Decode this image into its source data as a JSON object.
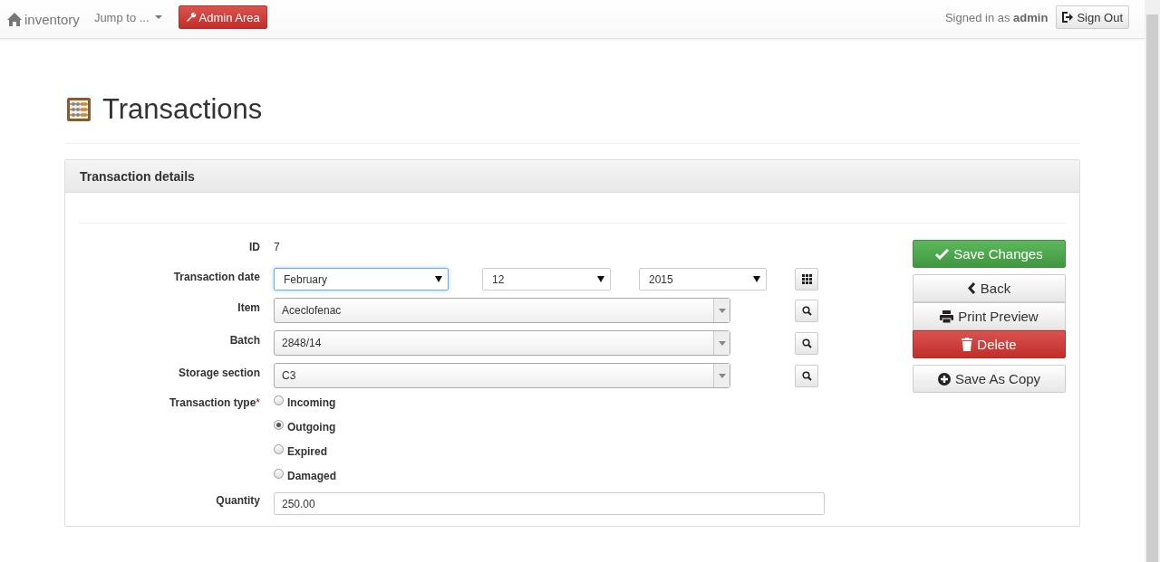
{
  "navbar": {
    "brand": "inventory",
    "jump_to": "Jump to ...",
    "admin_button": "Admin Area",
    "signed_in": "Signed in as **admin**",
    "sign_out": "Sign Out"
  },
  "page": {
    "title": "Transactions"
  },
  "panel": {
    "title": "Transaction details",
    "id": {
      "label": "ID",
      "value": "7"
    },
    "date": {
      "label": "Transaction date",
      "selects": [
        {
          "value": "February",
          "focused": true
        },
        {
          "value": "12",
          "focused": false
        },
        {
          "value": "2015",
          "focused": false
        }
      ]
    },
    "lookups": [
      {
        "label": "Item",
        "value": "Aceclofenac"
      },
      {
        "label": "Batch",
        "value": "2848/14"
      },
      {
        "label": "Storage section",
        "value": "C3"
      }
    ],
    "transaction_type": {
      "label": "Transaction type",
      "required_mark": "*",
      "options": [
        {
          "label": "Incoming",
          "selected": false
        },
        {
          "label": "Outgoing",
          "selected": true
        },
        {
          "label": "Expired",
          "selected": false
        },
        {
          "label": "Damaged",
          "selected": false
        }
      ]
    },
    "quantity": {
      "label": "Quantity",
      "value": "250.00"
    },
    "actions": [
      {
        "kind": "save",
        "label": "Save Changes"
      },
      {
        "kind": "back",
        "label": "Back"
      },
      {
        "kind": "print",
        "label": "Print Preview"
      },
      {
        "kind": "delete",
        "label": "Delete"
      },
      {
        "kind": "copy",
        "label": "Save As Copy"
      }
    ]
  }
}
